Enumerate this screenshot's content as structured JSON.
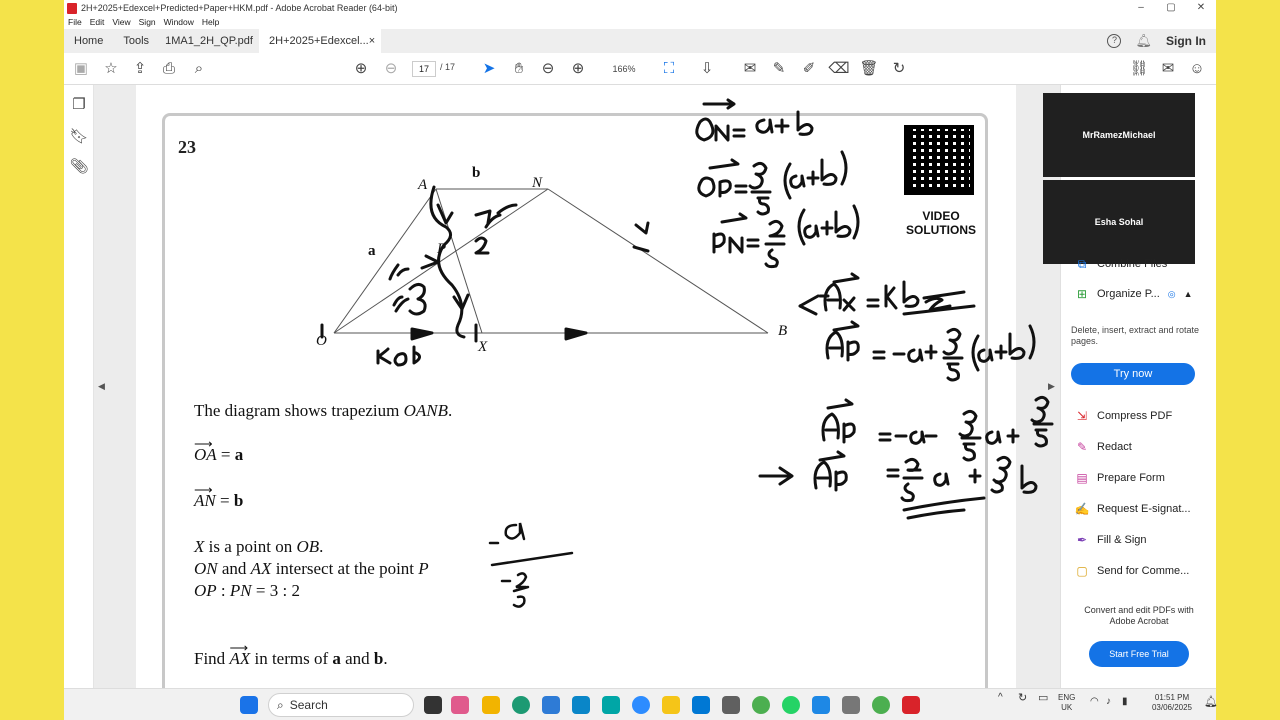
{
  "window": {
    "title": "2H+2025+Edexcel+Predicted+Paper+HKM.pdf - Adobe Acrobat Reader (64-bit)",
    "minimize": "–",
    "maximize": "▢",
    "close": "✕"
  },
  "menu": [
    "File",
    "Edit",
    "View",
    "Sign",
    "Window",
    "Help"
  ],
  "tabs": {
    "home": "Home",
    "tools": "Tools",
    "file1": "1MA1_2H_QP.pdf",
    "file2": "2H+2025+Edexcel...",
    "close": "×",
    "help": "?",
    "signin": "Sign In"
  },
  "toolbar": {
    "page_current": "17",
    "page_total": "/ 17",
    "zoom": "166%"
  },
  "question": {
    "number": "23",
    "line1_prefix": "The diagram shows trapezium ",
    "line1_name": "OANB",
    "oa_vec": "OA",
    "oa_rhs": " = ",
    "oa_val": "a",
    "an_vec": "AN",
    "an_rhs": " = ",
    "an_val": "b",
    "x_line_var": "X",
    "x_line_mid": " is a point on ",
    "x_line_ob": "OB",
    "x_line_end": ".",
    "on_line_a": "ON",
    "on_line_mid1": " and ",
    "on_line_b": "AX",
    "on_line_mid2": " intersect at the point ",
    "on_line_p": "P",
    "ratio_a": "OP",
    "ratio_mid": " : ",
    "ratio_b": "PN",
    "ratio_val": " = 3 : 2",
    "find_prefix": "Find ",
    "find_vec": "AX",
    "find_mid": " in terms of ",
    "find_a": "a",
    "find_and": " and ",
    "find_b": "b",
    "find_end": "."
  },
  "diagram": {
    "labels": [
      "A",
      "b",
      "N",
      "a",
      "P",
      "O",
      "X",
      "B"
    ]
  },
  "qr_label": "VIDEO\nSOLUTIONS",
  "participants": [
    "MrRamezMichael",
    "Esha Sohal"
  ],
  "panel": {
    "combine": "Combine Files",
    "organize": "Organize P...",
    "note": "Delete, insert, extract and rotate pages.",
    "try_now": "Try now",
    "compress": "Compress PDF",
    "redact": "Redact",
    "prepare": "Prepare Form",
    "request": "Request E-signat...",
    "fill": "Fill & Sign",
    "send": "Send for Comme...",
    "promo": "Convert and edit PDFs with Adobe Acrobat",
    "trial": "Start Free Trial"
  },
  "taskbar": {
    "search": "Search",
    "lang_top": "ENG",
    "lang_bottom": "UK",
    "time": "01:51 PM",
    "date": "03/06/2025"
  },
  "colors": {
    "border_yellow": "#f4e34a",
    "accent_blue": "#1473e6",
    "pdf_red": "#d9232a"
  }
}
